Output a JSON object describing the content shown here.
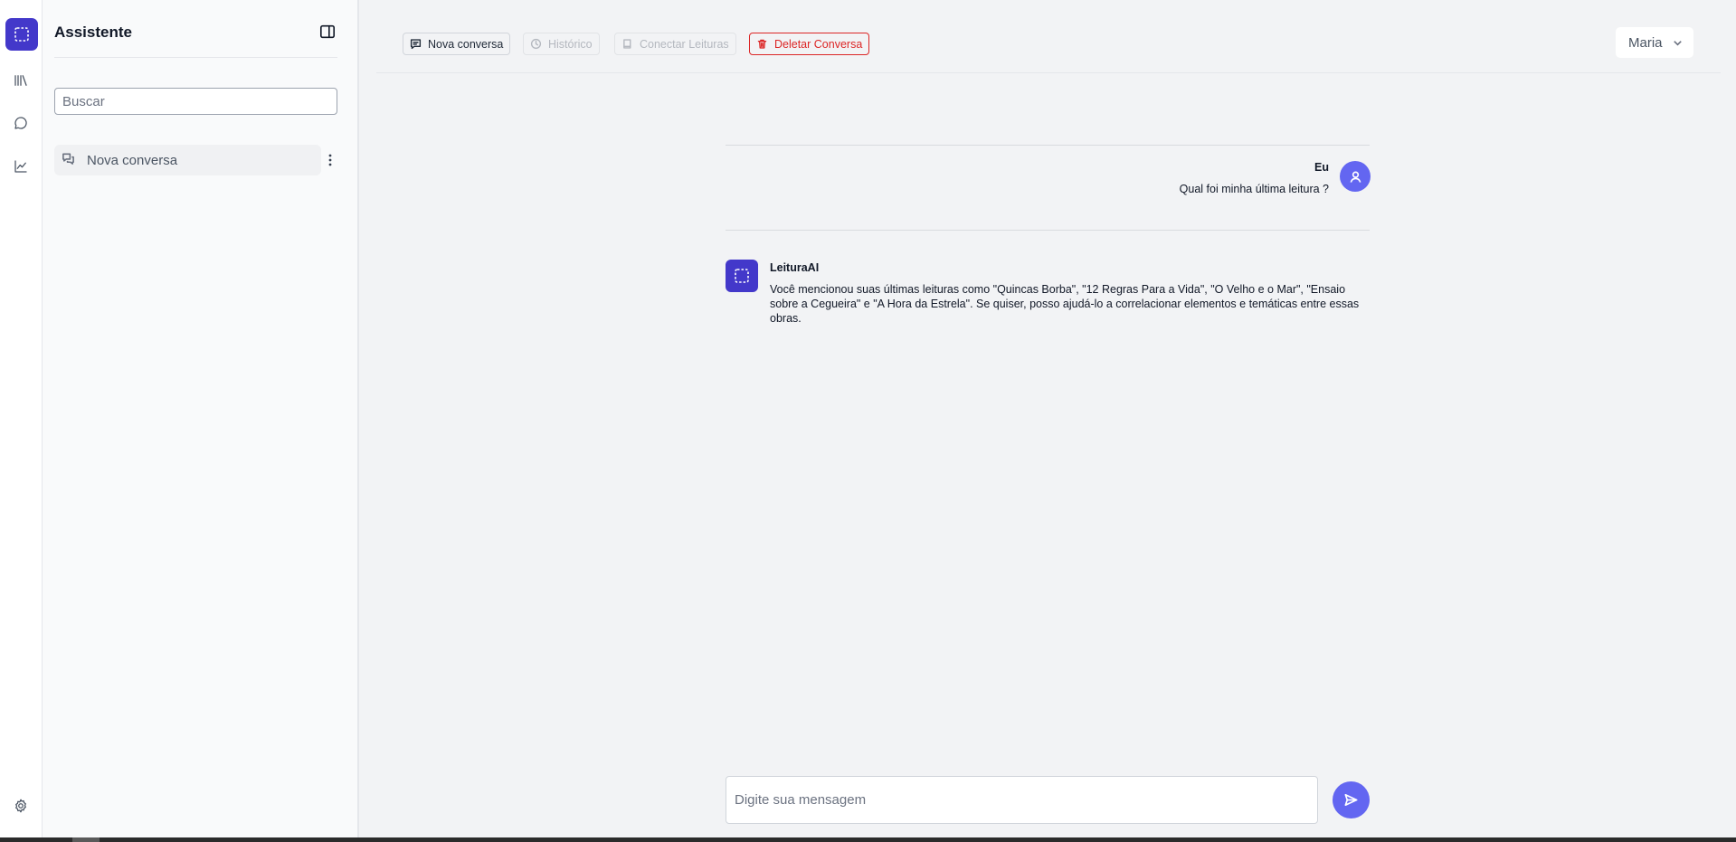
{
  "sidebar": {
    "title": "Assistente",
    "search_placeholder": "Buscar",
    "conversations": [
      {
        "label": "Nova conversa"
      }
    ]
  },
  "toolbar": {
    "new_conversation": "Nova conversa",
    "history": "Histórico",
    "connect_readings": "Conectar Leituras",
    "delete_conversation": "Deletar Conversa"
  },
  "user_menu": {
    "selected": "Maria"
  },
  "messages": [
    {
      "author": "Eu",
      "text": "Qual foi minha última leitura ?"
    },
    {
      "author": "LeituraAI",
      "text": "Você mencionou suas últimas leituras como \"Quincas Borba\", \"12 Regras Para a Vida\", \"O Velho e o Mar\", \"Ensaio sobre a Cegueira\" e \"A Hora da Estrela\". Se quiser, posso ajudá-lo a correlacionar elementos e temáticas entre essas obras."
    }
  ],
  "composer": {
    "placeholder": "Digite sua mensagem"
  },
  "colors": {
    "brand": "#4338ca",
    "accent": "#6366f1",
    "danger": "#dc2626"
  },
  "icons": {
    "rail": [
      "app-logo-icon",
      "library-icon",
      "chat-bubble-icon",
      "line-chart-icon",
      "settings-gear-icon"
    ]
  }
}
